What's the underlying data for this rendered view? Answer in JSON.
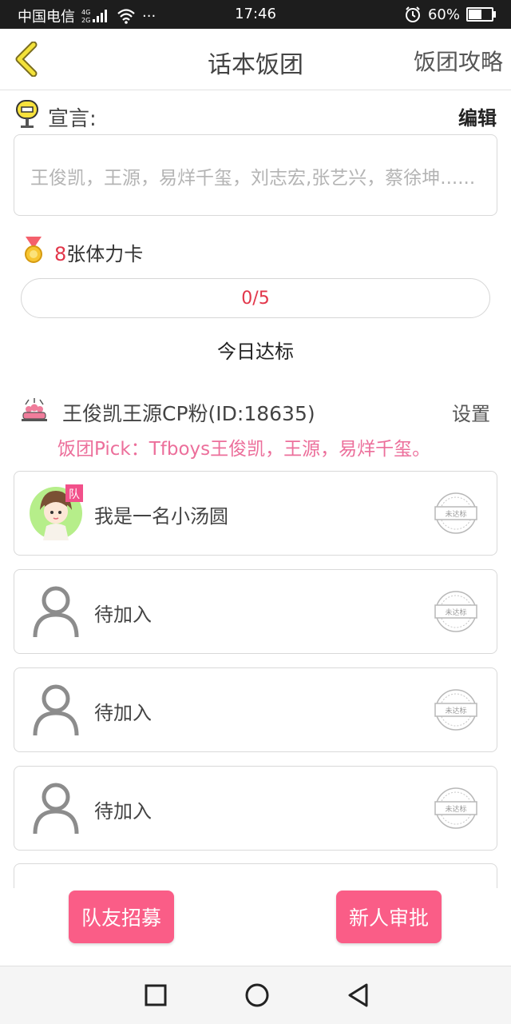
{
  "status_bar": {
    "carrier": "中国电信",
    "network": "4G 2G",
    "more": "···",
    "time": "17:46",
    "battery_percent": "60%",
    "battery_level": 0.6
  },
  "nav": {
    "back_icon": "chevron-left-icon",
    "title": "话本饭团",
    "guide_label": "饭团攻略"
  },
  "declaration": {
    "label": "宣言:",
    "edit_label": "编辑",
    "text": "王俊凯，王源，易烊千玺，刘志宏,张艺兴，蔡徐坤......"
  },
  "stamina": {
    "count": "8",
    "unit_label": "张体力卡",
    "progress_text": "0/5",
    "progress_value": 0,
    "progress_max": 5,
    "daily_label": "今日达标"
  },
  "team": {
    "name": "王俊凯王源CP粉(ID:18635)",
    "settings_label": "设置",
    "pick": "饭团Pick：Tfboys王俊凯，王源，易烊千玺。"
  },
  "members": [
    {
      "name": "我是一名小汤圆",
      "badge": "队",
      "status": "未达标",
      "avatar": "chibi-avatar"
    },
    {
      "name": "待加入",
      "status": "未达标",
      "avatar": "person-placeholder-icon"
    },
    {
      "name": "待加入",
      "status": "未达标",
      "avatar": "person-placeholder-icon"
    },
    {
      "name": "待加入",
      "status": "未达标",
      "avatar": "person-placeholder-icon"
    }
  ],
  "actions": {
    "recruit_label": "队友招募",
    "approve_label": "新人审批"
  },
  "colors": {
    "accent_pink": "#fa5d87",
    "pick_pink": "#ec6f9b",
    "number_red": "#e2364a",
    "back_yellow": "#f3e23a"
  }
}
